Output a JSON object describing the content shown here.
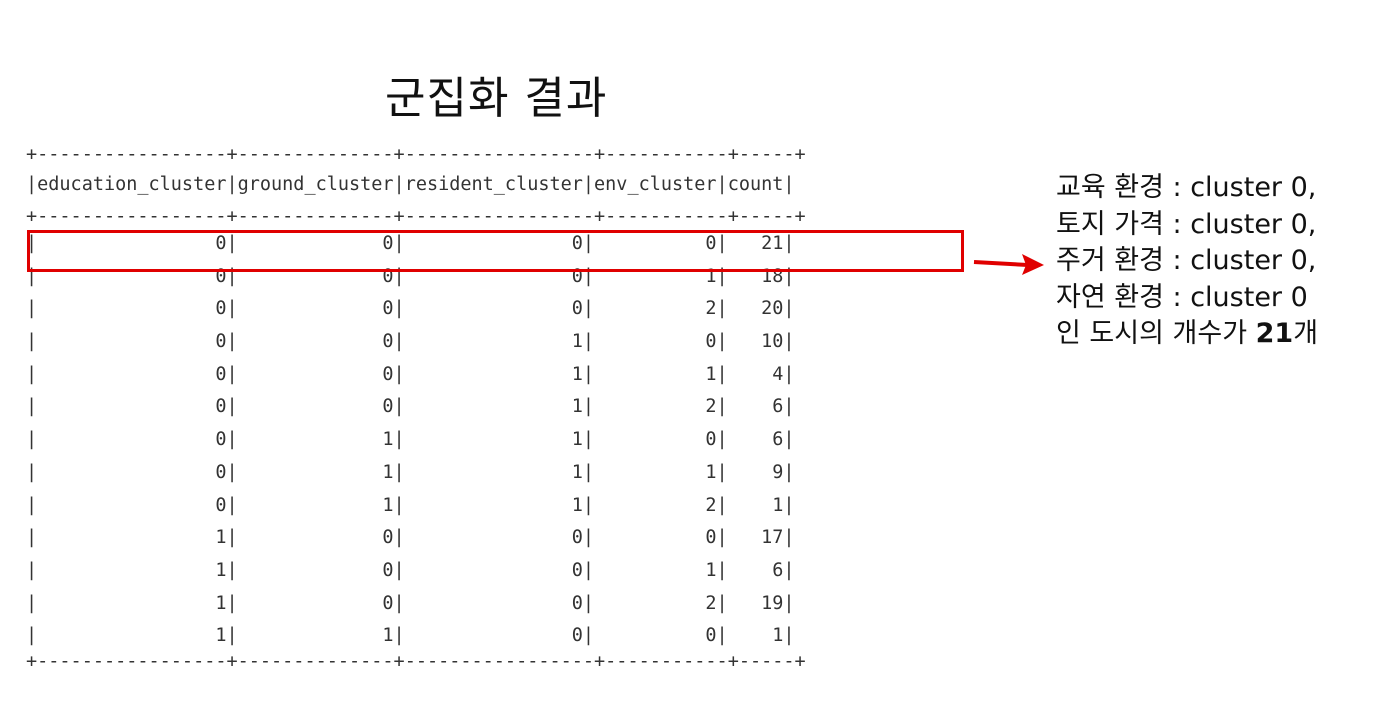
{
  "title": "군집화 결과",
  "table": {
    "border_line": "+-----------------+--------------+-----------------+-----------+-----+",
    "header_line": "|education_cluster|ground_cluster|resident_cluster|env_cluster|count|",
    "columns": [
      "education_cluster",
      "ground_cluster",
      "resident_cluster",
      "env_cluster",
      "count"
    ],
    "rows": [
      [
        0,
        0,
        0,
        0,
        21
      ],
      [
        0,
        0,
        0,
        1,
        18
      ],
      [
        0,
        0,
        0,
        2,
        20
      ],
      [
        0,
        0,
        1,
        0,
        10
      ],
      [
        0,
        0,
        1,
        1,
        4
      ],
      [
        0,
        0,
        1,
        2,
        6
      ],
      [
        0,
        1,
        1,
        0,
        6
      ],
      [
        0,
        1,
        1,
        1,
        9
      ],
      [
        0,
        1,
        1,
        2,
        1
      ],
      [
        1,
        0,
        0,
        0,
        17
      ],
      [
        1,
        0,
        0,
        1,
        6
      ],
      [
        1,
        0,
        0,
        2,
        19
      ],
      [
        1,
        1,
        0,
        0,
        1
      ]
    ]
  },
  "annotation": {
    "lines": [
      "교육 환경 : cluster 0,",
      "토지 가격 : cluster 0,",
      "주거 환경 : cluster 0,",
      "자연 환경 : cluster 0"
    ],
    "last_line_prefix": "인 도시의 개수가 ",
    "last_line_count": "21",
    "last_line_suffix": "개",
    "highlight_color": "#e00000"
  }
}
